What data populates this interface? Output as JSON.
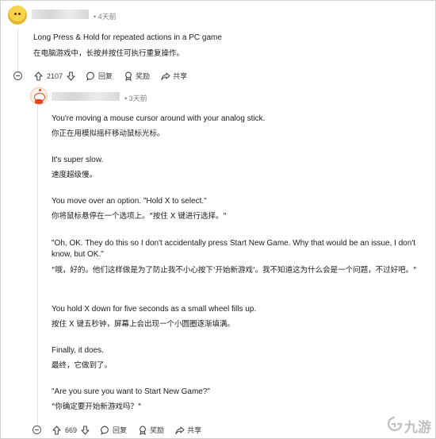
{
  "comment": {
    "time": "• 4天前",
    "lines": [
      "Long Press & Hold for repeated actions in a PC game",
      "在电脑游戏中，长按并按住可执行重复操作。"
    ],
    "actions": {
      "votes": "2107",
      "reply": "回复",
      "award": "奖励",
      "share": "共享"
    }
  },
  "reply": {
    "time": "• 3天前",
    "paragraphs": [
      {
        "en": "You're moving a mouse cursor around with your analog stick.",
        "cn": "你正在用模拟摇杆移动鼠标光标。"
      },
      {
        "en": "It's super slow.",
        "cn": "速度超级慢。"
      },
      {
        "en": "You move over an option. \"Hold X to select.\"",
        "cn": "你将鼠标悬停在一个选项上。\"按住 X 键进行选择。\""
      },
      {
        "en": "\"Oh, OK. They do this so I don't accidentally press Start New Game. Why that would be an issue, I don't know, but OK.\"",
        "cn": "\"哦，好的。他们这样做是为了防止我不小心按下'开始新游戏'。我不知道这为什么会是一个问题，不过好吧。\""
      },
      {
        "en": "You hold X down for five seconds as a small wheel fills up.",
        "cn": "按住 X 键五秒钟，屏幕上会出现一个小圆圈逐渐填满。"
      },
      {
        "en": "Finally, it does.",
        "cn": "最终，它做到了。"
      },
      {
        "en": "\"Are you sure you want to Start New Game?\"",
        "cn": "\"你确定要开始新游戏吗？\""
      }
    ],
    "actions": {
      "votes": "669",
      "reply": "回复",
      "award": "奖励",
      "share": "共享"
    }
  },
  "watermark": {
    "text": "九游"
  },
  "icons": {
    "upvote": "arrow-up-icon",
    "downvote": "arrow-down-icon",
    "reply": "comment-bubble-icon",
    "award": "award-icon",
    "share": "share-icon",
    "collapse": "collapse-minus-icon"
  }
}
